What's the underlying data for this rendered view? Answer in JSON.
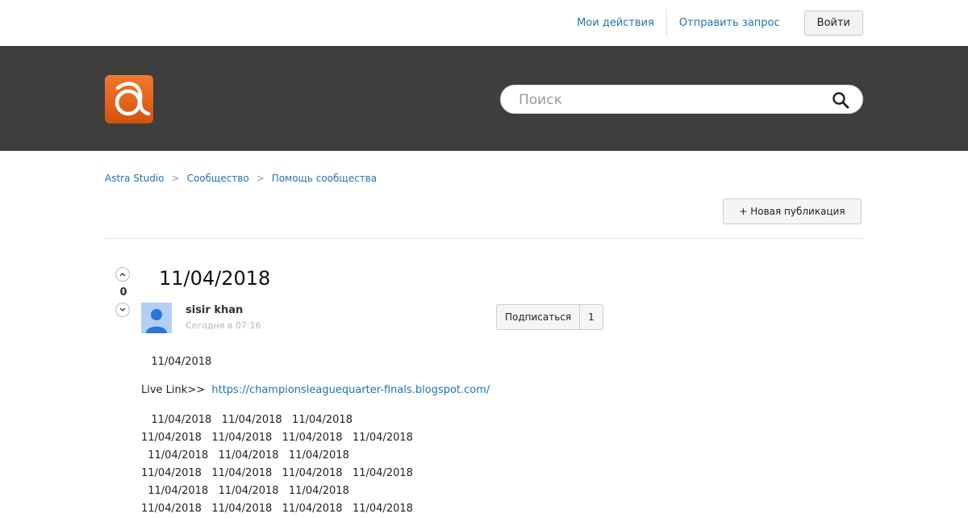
{
  "topnav": {
    "my_activities": "Мои действия",
    "submit_request": "Отправить запрос",
    "login": "Войти"
  },
  "search": {
    "placeholder": "Поиск"
  },
  "breadcrumb": {
    "items": [
      "Astra Studio",
      "Сообщество",
      "Помощь сообщества"
    ],
    "separator": ">"
  },
  "new_post_label": "+ Новая публикация",
  "post": {
    "title": "11/04/2018",
    "vote_count": "0",
    "author": "sisir khan",
    "timestamp": "Сегодня в 07:16",
    "subscribe_label": "Подписаться",
    "subscribe_count": "1",
    "body": {
      "line1": "   11/04/2018",
      "live_link_label": "Live Link>>  ",
      "live_link_url": "https://championsleaguequarter-finals.blogspot.com/",
      "grid_lines": [
        "   11/04/2018   11/04/2018   11/04/2018",
        "11/04/2018   11/04/2018   11/04/2018   11/04/2018",
        "  11/04/2018   11/04/2018   11/04/2018",
        "11/04/2018   11/04/2018   11/04/2018   11/04/2018",
        "  11/04/2018   11/04/2018   11/04/2018",
        "11/04/2018   11/04/2018   11/04/2018   11/04/2018"
      ]
    }
  },
  "colors": {
    "link": "#1f73b7",
    "hero_bg": "#3e3e3e",
    "logo_orange": "#e8641c"
  }
}
